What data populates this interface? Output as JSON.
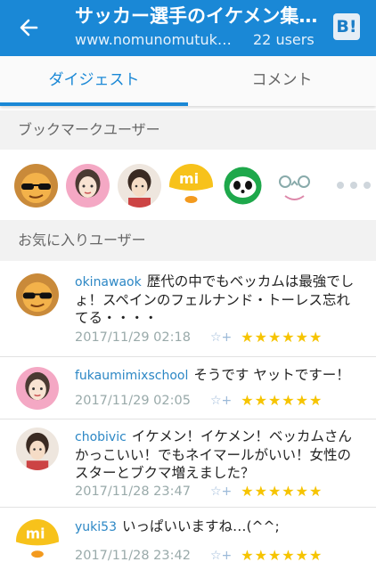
{
  "header": {
    "title": "サッカー選手のイケメン集…",
    "url": "www.nomunomutuk…",
    "users": "22 users",
    "hatena_badge": "B!"
  },
  "tabs": [
    {
      "label": "ダイジェスト"
    },
    {
      "label": "コメント"
    }
  ],
  "sections": {
    "bookmark_users": "ブックマークユーザー",
    "favorite_users": "お気に入りユーザー"
  },
  "comments": [
    {
      "user": "okinawaok",
      "text": "歴代の中でもベッカムは最強でしょ！スペインのフェルナンド・トーレス忘れてる・・・・",
      "time": "2017/11/29 02:18",
      "stars": "★★★★★★"
    },
    {
      "user": "fukaumimixschool",
      "text": "そうです ヤットですー！",
      "time": "2017/11/29 02:05",
      "stars": "★★★★★★"
    },
    {
      "user": "chobivic",
      "text": "イケメン！イケメン！ベッカムさんかっこいい！でもネイマールがいい！女性のスターとブクマ増えました？",
      "time": "2017/11/28 23:47",
      "stars": "★★★★★★"
    },
    {
      "user": "yuki53",
      "text": "いっぱいいますね…(^^;",
      "time": "2017/11/28 23:42",
      "stars": "★★★★★★"
    }
  ],
  "colors": {
    "accent": "#1a88d6",
    "star": "#f6c400",
    "username": "#2c87c5"
  },
  "icons": {
    "back": "arrow-left-icon",
    "add_star": "add-star-icon"
  }
}
